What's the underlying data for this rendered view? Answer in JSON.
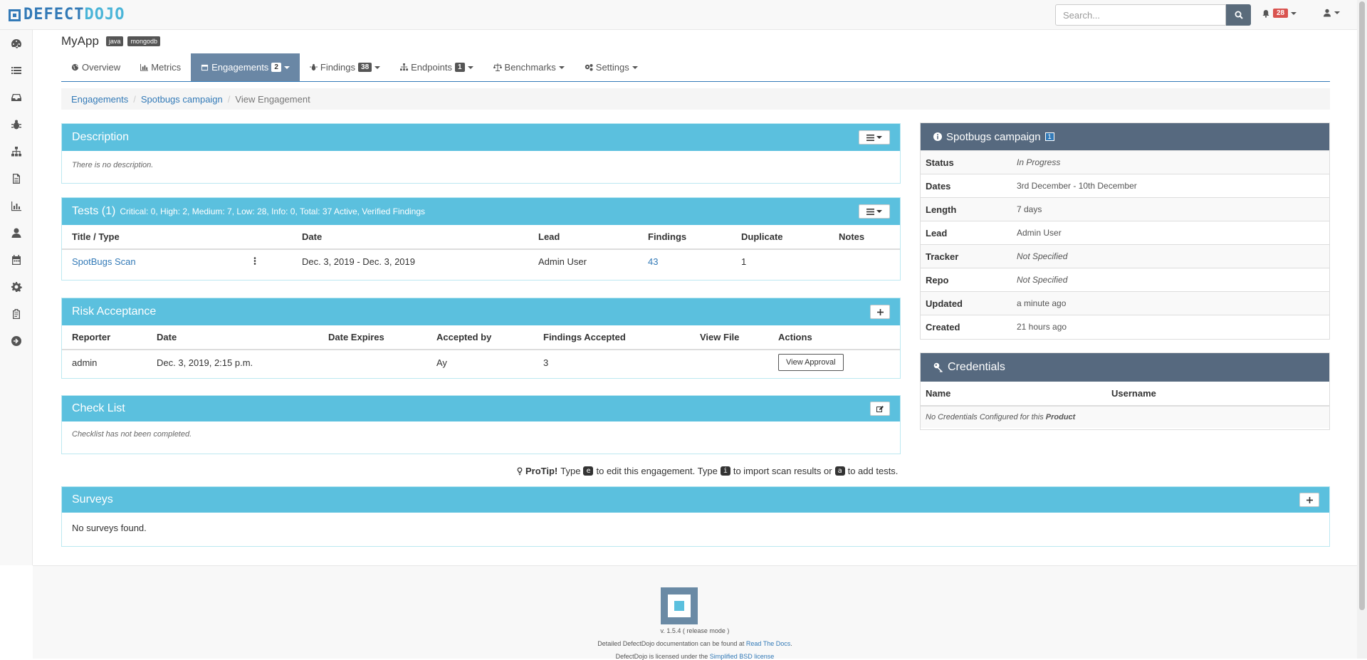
{
  "brand": {
    "part1": "DEFECT",
    "part2": "DOJO"
  },
  "search": {
    "placeholder": "Search..."
  },
  "notifications": {
    "count": "28"
  },
  "product": {
    "name": "MyApp",
    "tags": [
      "java",
      "mongodb"
    ]
  },
  "tabs": [
    {
      "label": "Overview"
    },
    {
      "label": "Metrics"
    },
    {
      "label": "Engagements",
      "count": "2"
    },
    {
      "label": "Findings",
      "count": "38"
    },
    {
      "label": "Endpoints",
      "count": "1"
    },
    {
      "label": "Benchmarks"
    },
    {
      "label": "Settings"
    }
  ],
  "breadcrumb": [
    "Engagements",
    "Spotbugs campaign",
    "View Engagement"
  ],
  "description": {
    "title": "Description",
    "text": "There is no description."
  },
  "tests": {
    "title": "Tests (1)",
    "summary": "Critical: 0, High: 2, Medium: 7, Low: 28, Info: 0, Total: 37 Active, Verified Findings",
    "headers": [
      "Title / Type",
      "Date",
      "Lead",
      "Findings",
      "Duplicate",
      "Notes"
    ],
    "row": {
      "title": "SpotBugs Scan",
      "date": "Dec. 3, 2019 - Dec. 3, 2019",
      "lead": "Admin User",
      "findings": "43",
      "duplicate": "1",
      "notes": ""
    }
  },
  "risk": {
    "title": "Risk Acceptance",
    "headers": [
      "Reporter",
      "Date",
      "Date Expires",
      "Accepted by",
      "Findings Accepted",
      "View File",
      "Actions"
    ],
    "row": {
      "reporter": "admin",
      "date": "Dec. 3, 2019, 2:15 p.m.",
      "expires": "",
      "accepted_by": "Ay",
      "findings": "3",
      "file": "",
      "action": "View Approval"
    }
  },
  "checklist": {
    "title": "Check List",
    "text": "Checklist has not been completed."
  },
  "protip": {
    "label": "ProTip!",
    "t1": "Type",
    "k1": "e",
    "t2": "to edit this engagement. Type",
    "k2": "i",
    "t3": "to import scan results or",
    "k3": "a",
    "t4": "to add tests."
  },
  "surveys": {
    "title": "Surveys",
    "text": "No surveys found."
  },
  "engagement": {
    "title": "Spotbugs campaign",
    "badge": "1",
    "rows": [
      {
        "key": "Status",
        "value": "In Progress"
      },
      {
        "key": "Dates",
        "value": "3rd December - 10th December"
      },
      {
        "key": "Length",
        "value": "7 days"
      },
      {
        "key": "Lead",
        "value": "Admin User"
      },
      {
        "key": "Tracker",
        "value": "Not Specified"
      },
      {
        "key": "Repo",
        "value": "Not Specified"
      },
      {
        "key": "Updated",
        "value": "a minute ago"
      },
      {
        "key": "Created",
        "value": "21 hours ago"
      }
    ]
  },
  "credentials": {
    "title": "Credentials",
    "headers": [
      "Name",
      "Username"
    ],
    "empty_prefix": "No Credentials Configured for this",
    "empty_bold": "Product"
  },
  "footer": {
    "version": "v. 1.5.4 ( release mode )",
    "docs_prefix": "Detailed DefectDojo documentation can be found at",
    "docs_link": "Read The Docs",
    "docs_suffix": ".",
    "license_prefix": "DefectDojo is licensed under the",
    "license_link": "Simplified BSD license"
  },
  "colors": {
    "info_panel": "#5bc0de",
    "dark_panel": "#56697f",
    "active_tab": "#6a87a5",
    "badge": "#d9534f"
  }
}
